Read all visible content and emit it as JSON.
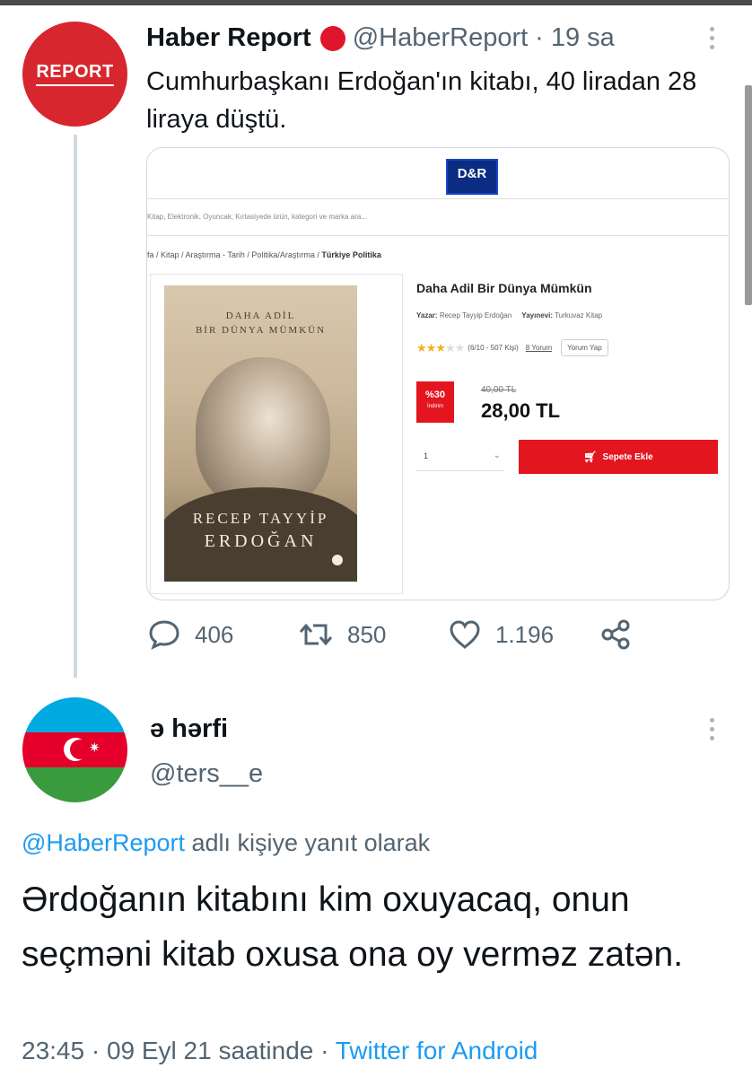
{
  "tweet1": {
    "avatar_text": "REPORT",
    "name": "Haber Report",
    "handle": "@HaberReport",
    "separator": "·",
    "time": "19 sa",
    "text": "Cumhurbaşkanı Erdoğan'ın kitabı, 40 liradan 28 liraya düştü.",
    "media": {
      "store_logo": "D&R",
      "search_placeholder": "Kitap, Elektronik, Oyuncak, Kırtasiyede ürün, kategori ve marka ara...",
      "breadcrumb": "fa / Kitap / Araştırma - Tarih / Politika/Araştırma / ",
      "breadcrumb_current": "Türkiye Politika",
      "book_cover": {
        "title_line1": "DAHA ADİL",
        "title_line2": "BİR DÜNYA MÜMKÜN",
        "author_line1": "RECEP TAYYİP",
        "author_line2": "ERDOĞAN"
      },
      "product_title": "Daha Adil Bir Dünya Mümkün",
      "author_label": "Yazar:",
      "author_value": "Recep Tayyip Erdoğan",
      "publisher_label": "Yayınevi:",
      "publisher_value": "Turkuvaz Kitap",
      "rating_stars": 3,
      "rating_text": "(6/10 - 507 Kişi)",
      "reviews_link": "8 Yorum",
      "review_button": "Yorum Yap",
      "discount_percent": "%30",
      "discount_label": "İndirim",
      "old_price": "40,00 TL",
      "new_price": "28,00 TL",
      "quantity": "1",
      "add_to_cart": "Sepete Ekle"
    },
    "actions": {
      "replies": "406",
      "retweets": "850",
      "likes": "1.196"
    }
  },
  "tweet2": {
    "name": "ə hərfi",
    "handle": "@ters__e",
    "reply_to_handle": "@HaberReport",
    "reply_to_suffix": " adlı kişiye yanıt olarak",
    "text": "Ərdoğanın kitabını kim oxuyacaq, onun seçməni kitab oxusa ona oy verməz zatən.",
    "timestamp": "23:45 · 09 Eyl 21 saatinde · ",
    "source": "Twitter for Android"
  },
  "colors": {
    "accent_blue": "#1d9bf0",
    "report_red": "#d7262d",
    "muted_text": "#536471"
  }
}
